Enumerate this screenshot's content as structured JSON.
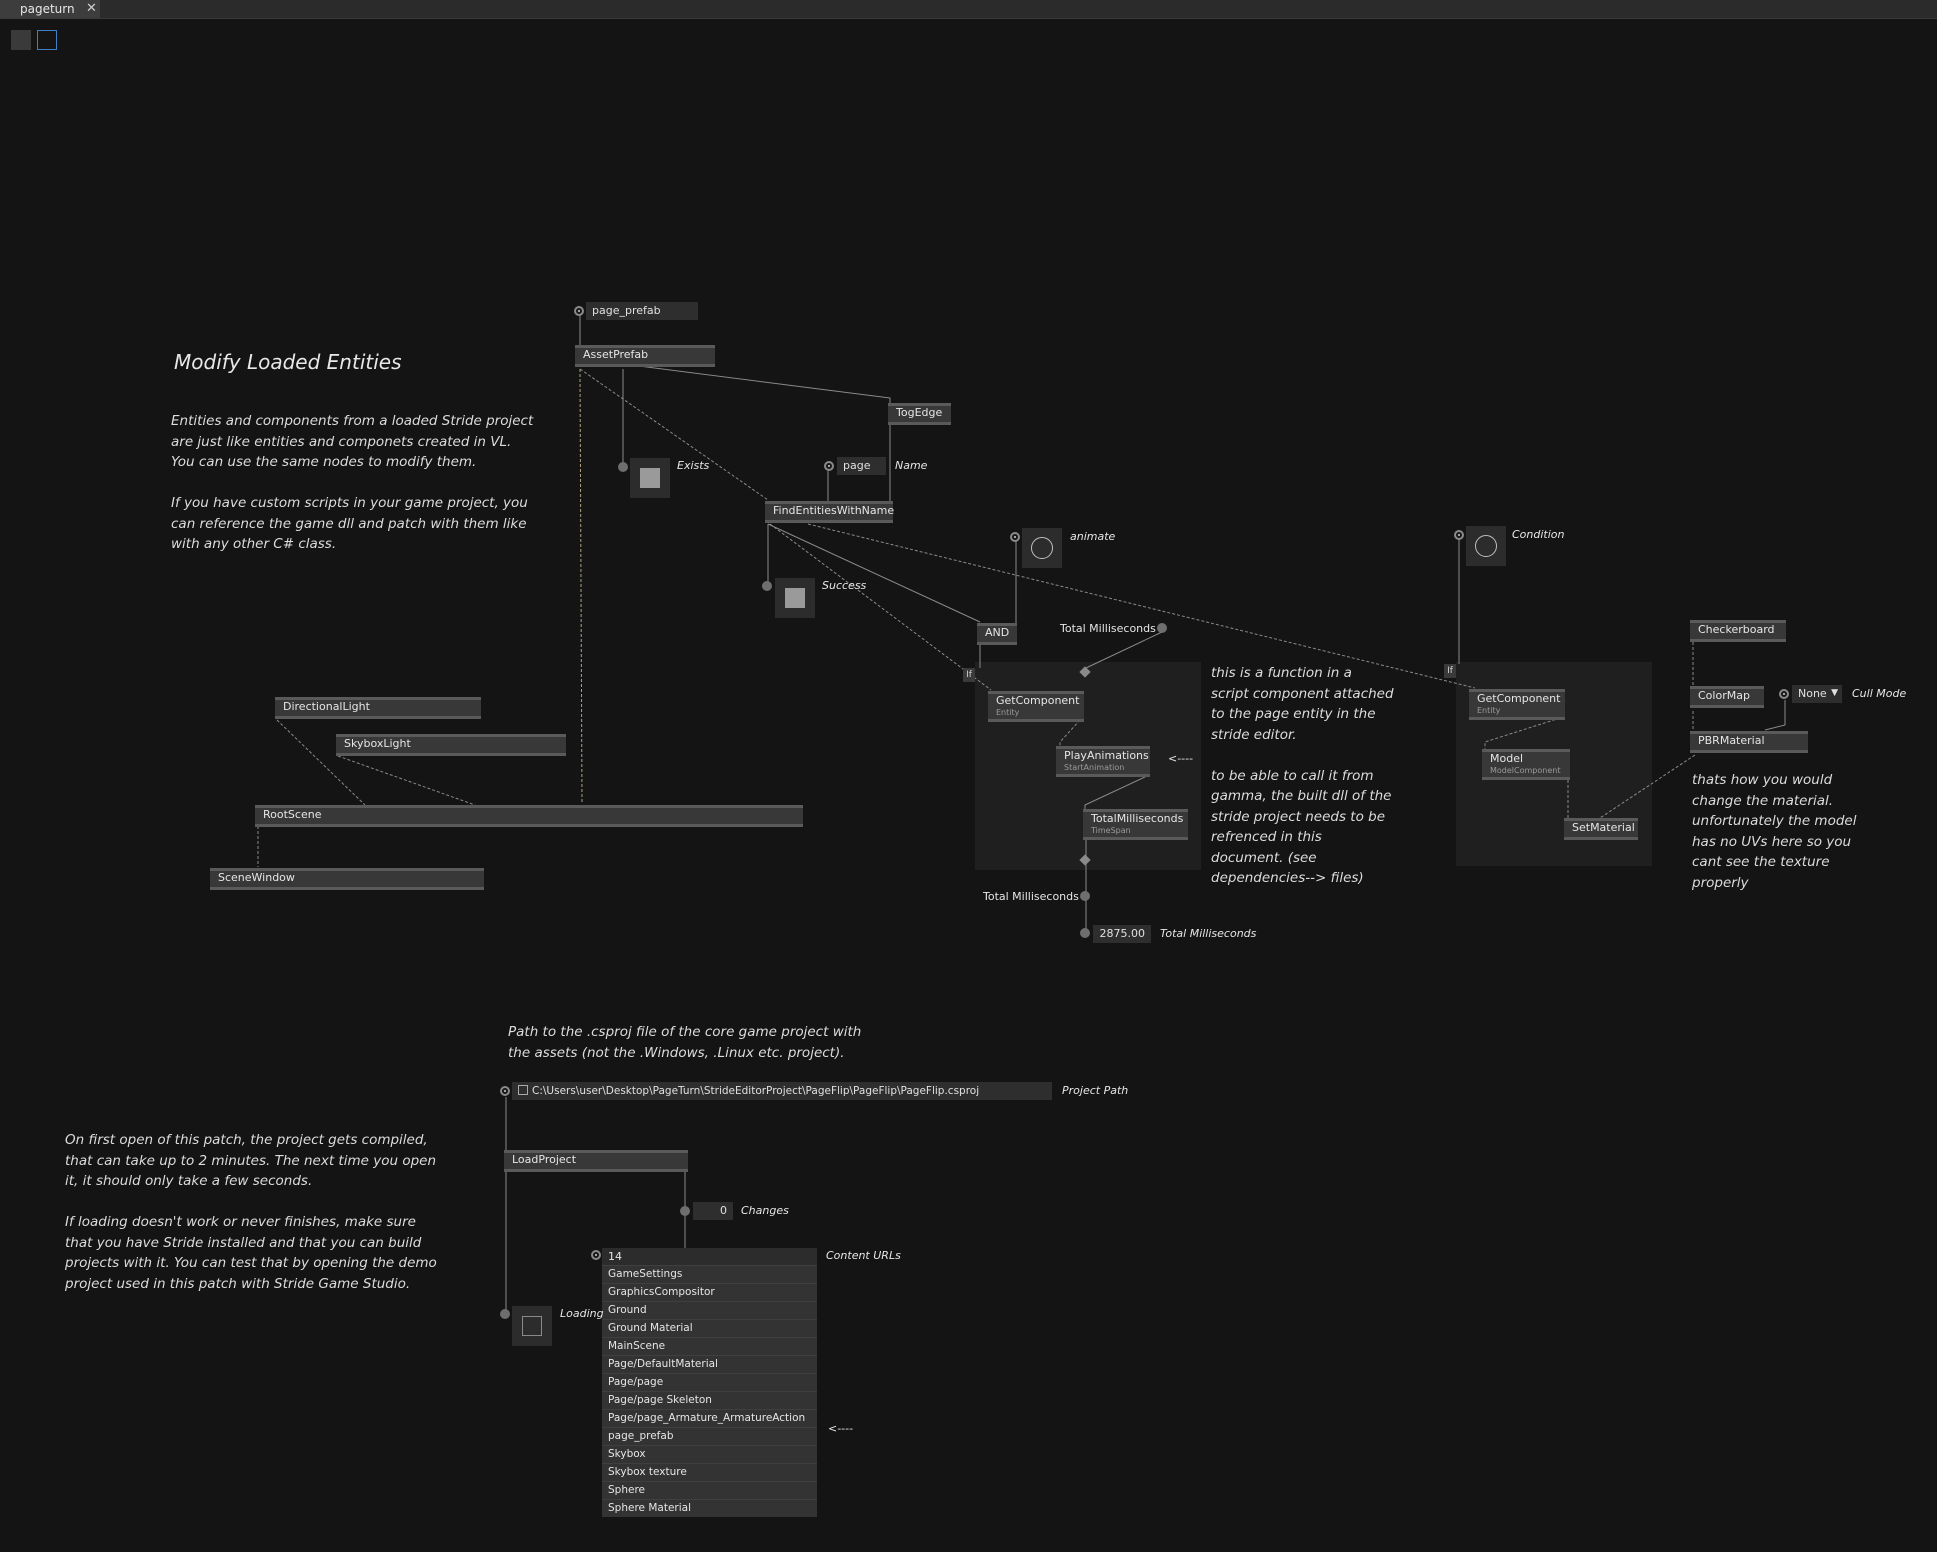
{
  "tab": {
    "title": "pageturn",
    "close": "✕"
  },
  "title": "Modify Loaded Entities",
  "comments": {
    "entities": "Entities and components from a loaded Stride project\nare just like entities and componets created in VL.\nYou can use the same nodes to modify them.\n\nIf you have custom scripts in your game project, you\ncan reference the game dll and patch with them like\nwith any other C# class.",
    "function": "this is a function in a\nscript component attached\nto the page entity in the\nstride editor.\n\nto be able to call it from\ngamma, the built dll of the\nstride project needs to be\nrefrenced in this\ndocument. (see\ndependencies--> files)",
    "material": "thats how you would\nchange the material.\nunfortunately the model\nhas no UVs here so you\ncant see the texture\nproperly",
    "path": "Path to the .csproj file of the core game project with\nthe assets (not the .Windows, .Linux etc. project).",
    "first_open": "On first open of this patch, the project gets compiled,\nthat can take up to 2 minutes. The next time you open\nit, it should only take a few seconds.\n\nIf loading doesn't work or never finishes, make sure\nthat you have Stride installed and that you can build\nprojects with it. You can test that by opening the demo\nproject used in this patch with Stride Game Studio.",
    "arrow_play": "<----",
    "arrow_list": "<----"
  },
  "nodes": {
    "asset_prefab": "AssetPrefab",
    "tog_edge": "TogEdge",
    "find_entities": "FindEntitiesWithName",
    "and": "AND",
    "get_component_1": {
      "name": "GetComponent",
      "sub": "Entity"
    },
    "play_animations": {
      "name": "PlayAnimations",
      "sub": "StartAnimation"
    },
    "total_ms_node": {
      "name": "TotalMilliseconds",
      "sub": "TimeSpan"
    },
    "get_component_2": {
      "name": "GetComponent",
      "sub": "Entity"
    },
    "model": {
      "name": "Model",
      "sub": "ModelComponent"
    },
    "set_material": "SetMaterial",
    "checkerboard": "Checkerboard",
    "colormap": "ColorMap",
    "pbr_material": "PBRMaterial",
    "directional_light": "DirectionalLight",
    "skybox_light": "SkyboxLight",
    "root_scene": "RootScene",
    "scene_window": "SceneWindow",
    "load_project": "LoadProject",
    "if_1": "If",
    "if_2": "If"
  },
  "io": {
    "page_prefab": "page_prefab",
    "page": "page",
    "total_ms_value": "2875.00",
    "cull_mode_value": "None",
    "project_path_value": "C:\\Users\\user\\Desktop\\PageTurn\\StrideEditorProject\\PageFlip\\PageFlip\\PageFlip.csproj",
    "changes_value": "0",
    "content_count": "14"
  },
  "labels": {
    "exists": "Exists",
    "name": "Name",
    "success": "Success",
    "animate": "animate",
    "condition": "Condition",
    "total_ms_in": "Total Milliseconds",
    "total_ms_out": "Total Milliseconds",
    "total_ms_value": "Total Milliseconds",
    "cull_mode": "Cull Mode",
    "project_path": "Project Path",
    "changes": "Changes",
    "content_urls": "Content URLs",
    "loading": "Loading"
  },
  "content_urls": [
    "GameSettings",
    "GraphicsCompositor",
    "Ground",
    "Ground Material",
    "MainScene",
    "Page/DefaultMaterial",
    "Page/page",
    "Page/page Skeleton",
    "Page/page_Armature_ArmatureAction",
    "page_prefab",
    "Skybox",
    "Skybox texture",
    "Sphere",
    "Sphere Material"
  ],
  "toggles": {
    "exists": true,
    "success": true,
    "loading": false
  }
}
